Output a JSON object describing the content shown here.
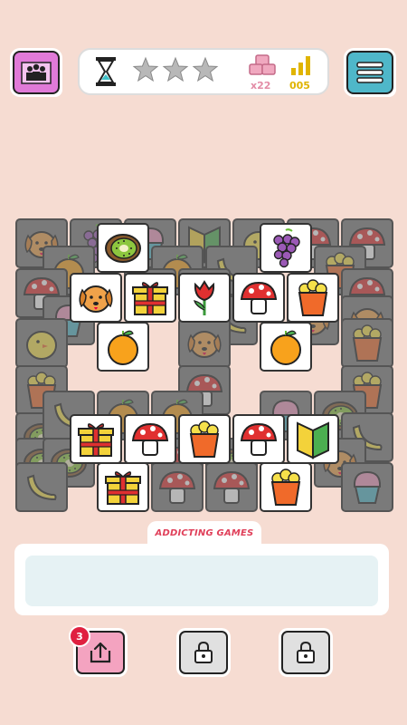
{
  "header": {
    "stars_filled": 0,
    "stars_total": 3,
    "tiles_remaining": "x22",
    "level": "005"
  },
  "brand": {
    "label": "ADDICTING GAMES"
  },
  "powerups": {
    "undo_count": "3"
  },
  "board": {
    "tiles": [
      {
        "icon": "dog",
        "dim": true
      },
      {
        "icon": "grapes",
        "dim": true
      },
      {
        "icon": "cupcake",
        "dim": true
      },
      {
        "icon": "beginner-leaf",
        "dim": true
      },
      {
        "icon": "chick",
        "dim": true
      },
      {
        "icon": "mushroom",
        "dim": true
      },
      {
        "icon": "mushroom",
        "dim": true
      },
      {
        "icon": "orange",
        "dim": true
      },
      {
        "icon": "orange",
        "dim": true
      },
      {
        "icon": "banana",
        "dim": true
      },
      {
        "icon": "popcorn",
        "dim": true
      },
      {
        "icon": "mushroom",
        "dim": true
      },
      {
        "icon": "mushroom",
        "dim": true
      },
      {
        "icon": "popcorn",
        "dim": true
      },
      {
        "icon": "mushroom",
        "dim": true
      },
      {
        "icon": "cupcake",
        "dim": true
      },
      {
        "icon": "banana",
        "dim": true
      },
      {
        "icon": "dog",
        "dim": true
      },
      {
        "icon": "dog",
        "dim": true
      },
      {
        "icon": "chick",
        "dim": true
      },
      {
        "icon": "dog",
        "dim": true
      },
      {
        "icon": "popcorn",
        "dim": true
      },
      {
        "icon": "popcorn",
        "dim": true
      },
      {
        "icon": "mushroom",
        "dim": true
      },
      {
        "icon": "popcorn",
        "dim": true
      },
      {
        "icon": "kiwi",
        "dim": true
      },
      {
        "icon": "banana",
        "dim": true
      },
      {
        "icon": "orange",
        "dim": true
      },
      {
        "icon": "orange",
        "dim": true
      },
      {
        "icon": "cupcake",
        "dim": true
      },
      {
        "icon": "kiwi",
        "dim": true
      },
      {
        "icon": "banana",
        "dim": true
      },
      {
        "icon": "kiwi",
        "dim": true
      },
      {
        "icon": "kiwi",
        "dim": true
      },
      {
        "icon": "mushroom",
        "dim": true
      },
      {
        "icon": "kiwi",
        "dim": true
      },
      {
        "icon": "dog",
        "dim": true
      },
      {
        "icon": "banana",
        "dim": true
      },
      {
        "icon": "mushroom",
        "dim": true
      },
      {
        "icon": "mushroom",
        "dim": true
      },
      {
        "icon": "cupcake",
        "dim": true
      },
      {
        "icon": "kiwi",
        "dim": false
      },
      {
        "icon": "grapes",
        "dim": false
      },
      {
        "icon": "dog",
        "dim": false
      },
      {
        "icon": "gift",
        "dim": false
      },
      {
        "icon": "tulip",
        "dim": false
      },
      {
        "icon": "mushroom",
        "dim": false
      },
      {
        "icon": "popcorn",
        "dim": false
      },
      {
        "icon": "orange",
        "dim": false
      },
      {
        "icon": "orange",
        "dim": false
      },
      {
        "icon": "gift",
        "dim": false
      },
      {
        "icon": "mushroom",
        "dim": false
      },
      {
        "icon": "popcorn",
        "dim": false
      },
      {
        "icon": "mushroom",
        "dim": false
      },
      {
        "icon": "beginner-leaf",
        "dim": false
      },
      {
        "icon": "gift",
        "dim": false
      },
      {
        "icon": "popcorn",
        "dim": false
      }
    ]
  }
}
